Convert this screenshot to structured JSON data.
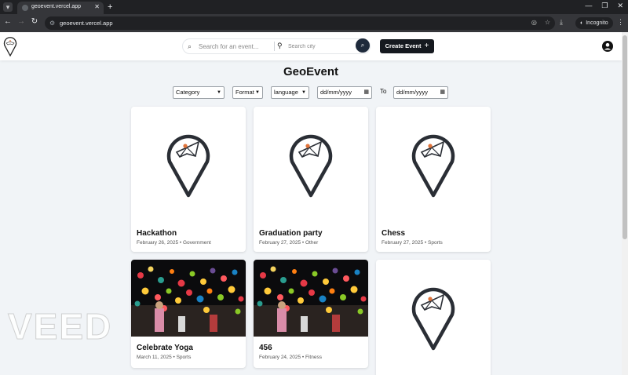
{
  "browser": {
    "tab_title": "geoevent.vercel.app",
    "url": "geoevent.vercel.app",
    "mode_label": "Incognito"
  },
  "header": {
    "search_placeholder": "Search for an event...",
    "city_placeholder": "Search city",
    "create_label": "Create Event"
  },
  "page": {
    "title": "GeoEvent"
  },
  "filters": {
    "category": "Category",
    "format": "Format",
    "language": "language",
    "date_from": "dd/mm/yyyy",
    "to_label": "To",
    "date_to": "dd/mm/yyyy"
  },
  "events": [
    {
      "title": "Hackathon",
      "meta": "February 26, 2025 • Government",
      "image": "pin-logo"
    },
    {
      "title": "Graduation party",
      "meta": "February 27, 2025 • Other",
      "image": "pin-logo"
    },
    {
      "title": "Chess",
      "meta": "February 27, 2025 • Sports",
      "image": "pin-logo"
    },
    {
      "title": "Celebrate Yoga",
      "meta": "March 11, 2025 • Sports",
      "image": "balloon-photo"
    },
    {
      "title": "456",
      "meta": "February 24, 2025 • Fitness",
      "image": "balloon-photo"
    },
    {
      "title": "",
      "meta": "",
      "image": "pin-logo"
    }
  ],
  "watermark": "VEED"
}
